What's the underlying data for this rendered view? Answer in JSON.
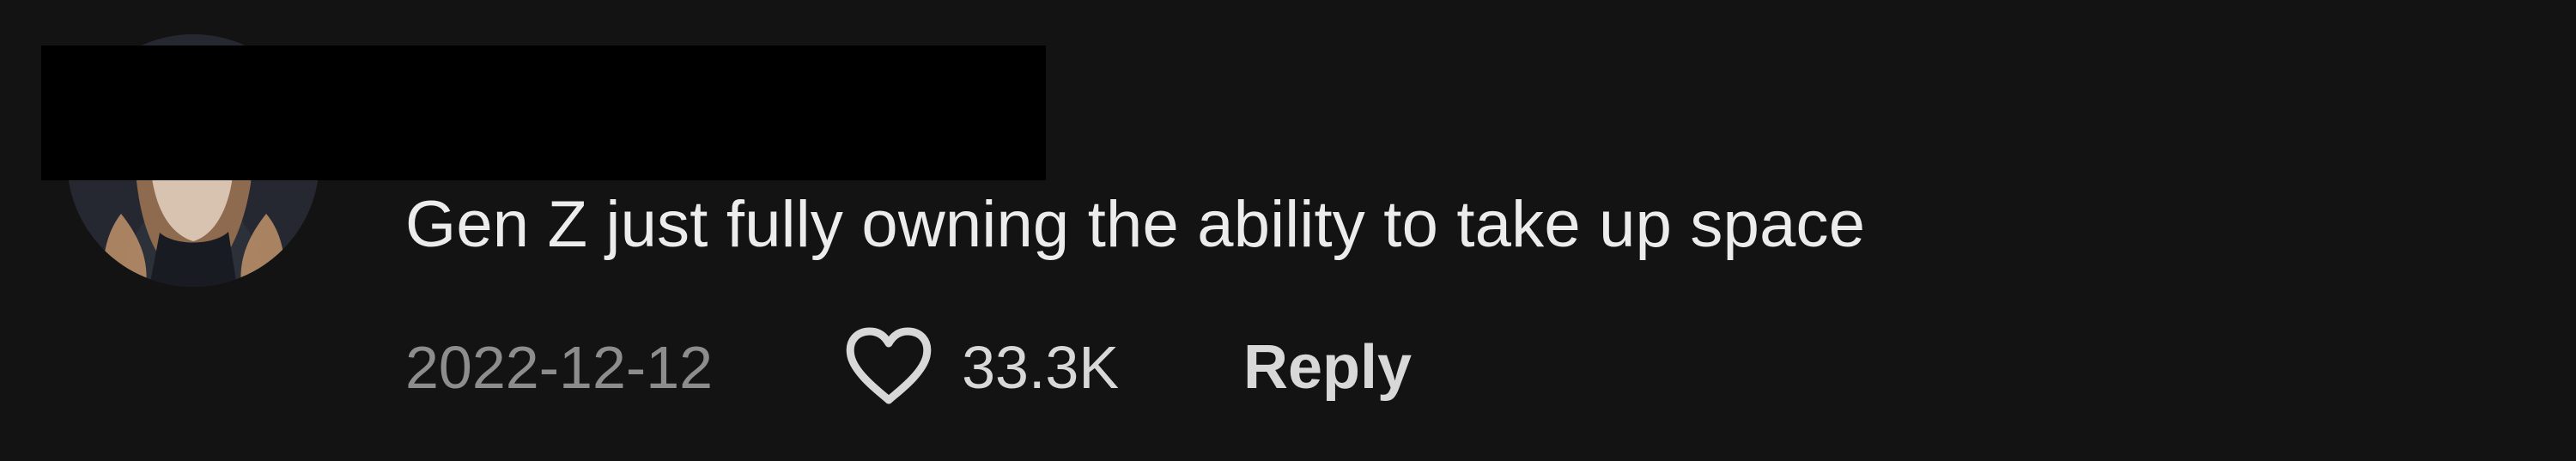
{
  "comment": {
    "avatar_icon": "user-avatar",
    "text": "Gen Z just fully owning the ability to take up space",
    "date": "2022-12-12",
    "likes": "33.3K",
    "like_icon": "heart-icon",
    "reply_label": "Reply"
  }
}
